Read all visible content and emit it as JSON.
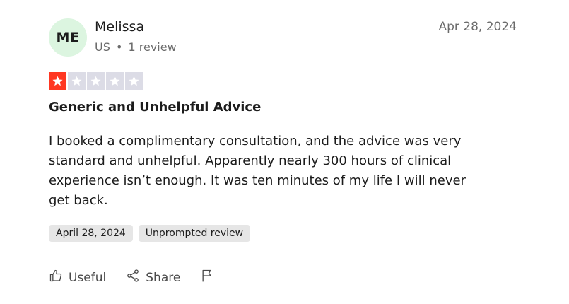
{
  "reviewer": {
    "initials": "ME",
    "name": "Melissa",
    "country": "US",
    "separator": "•",
    "review_count": "1 review"
  },
  "review": {
    "date": "Apr 28, 2024",
    "rating": 1,
    "max_rating": 5,
    "title": "Generic and Unhelpful Advice",
    "body": "I booked a complimentary consultation, and the advice was very standard and unhelpful. Apparently nearly 300 hours of clinical experience isn’t enough. It was ten minutes of my life I will never get back.",
    "experience_date": "April 28, 2024",
    "review_type": "Unprompted review"
  },
  "actions": {
    "useful_label": "Useful",
    "share_label": "Share"
  },
  "colors": {
    "star_filled": "#ff3722",
    "star_empty": "#dcdce6",
    "avatar_bg": "#dcf5e0"
  },
  "icons": [
    "star-icon",
    "thumbs-up-icon",
    "share-icon",
    "flag-icon"
  ]
}
